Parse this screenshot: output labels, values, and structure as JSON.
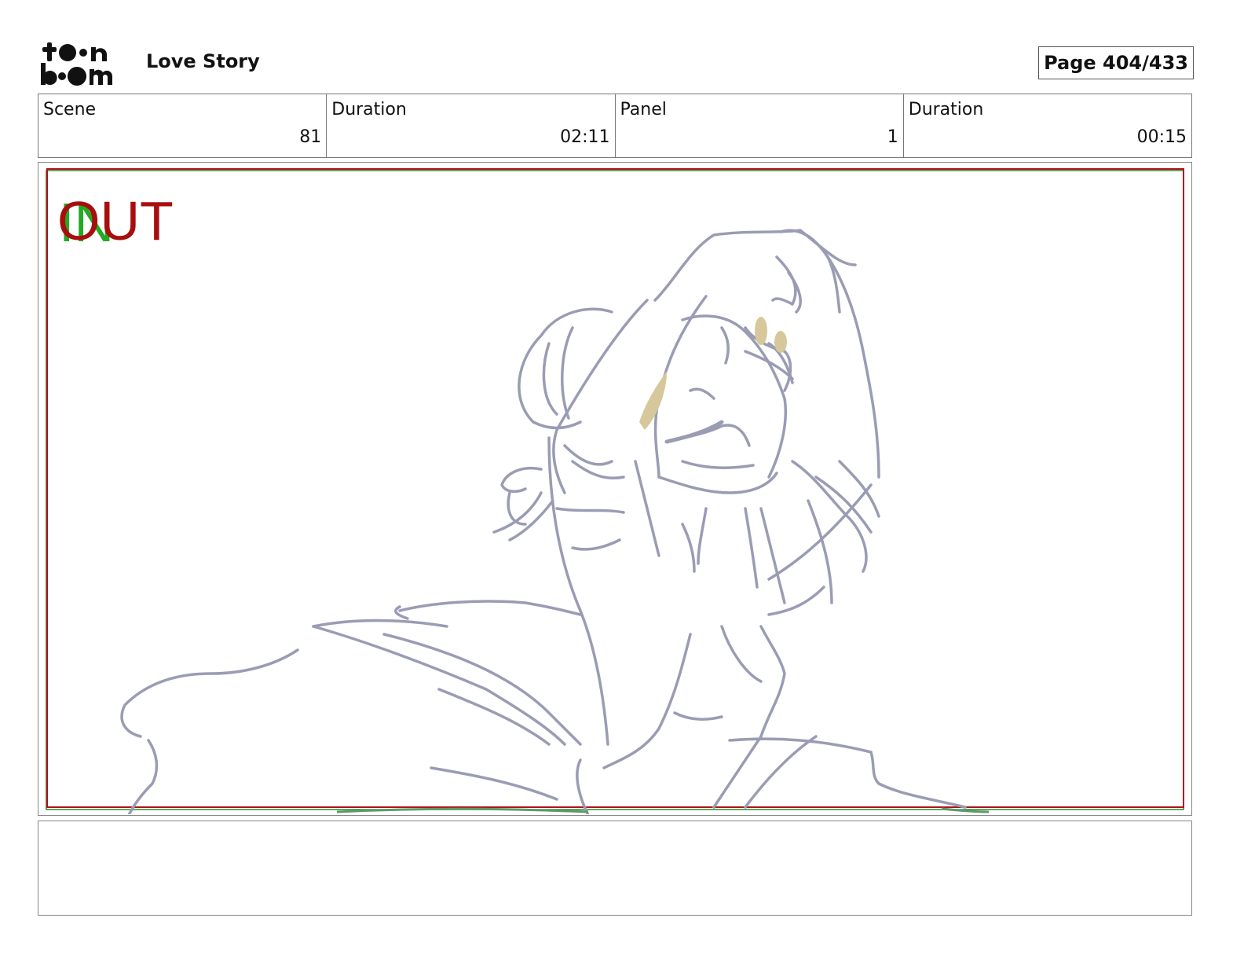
{
  "header": {
    "logo_text": "toon boom",
    "project_title": "Love Story",
    "page_label": "Page 404/433"
  },
  "info": [
    {
      "label": "Scene",
      "value": "81"
    },
    {
      "label": "Duration",
      "value": "02:11"
    },
    {
      "label": "Panel",
      "value": "1"
    },
    {
      "label": "Duration",
      "value": "00:15"
    }
  ],
  "panel": {
    "in_marker": "IN",
    "out_marker": "OUT",
    "colors": {
      "safe_frame": "#b0121a",
      "action_frame": "#2a8a2a",
      "in_marker": "#22aa22",
      "out_marker": "#a80e0e",
      "sketch_line": "#9a9cb4",
      "accent_fill": "#d6c89a"
    }
  },
  "notes": {
    "text": ""
  }
}
